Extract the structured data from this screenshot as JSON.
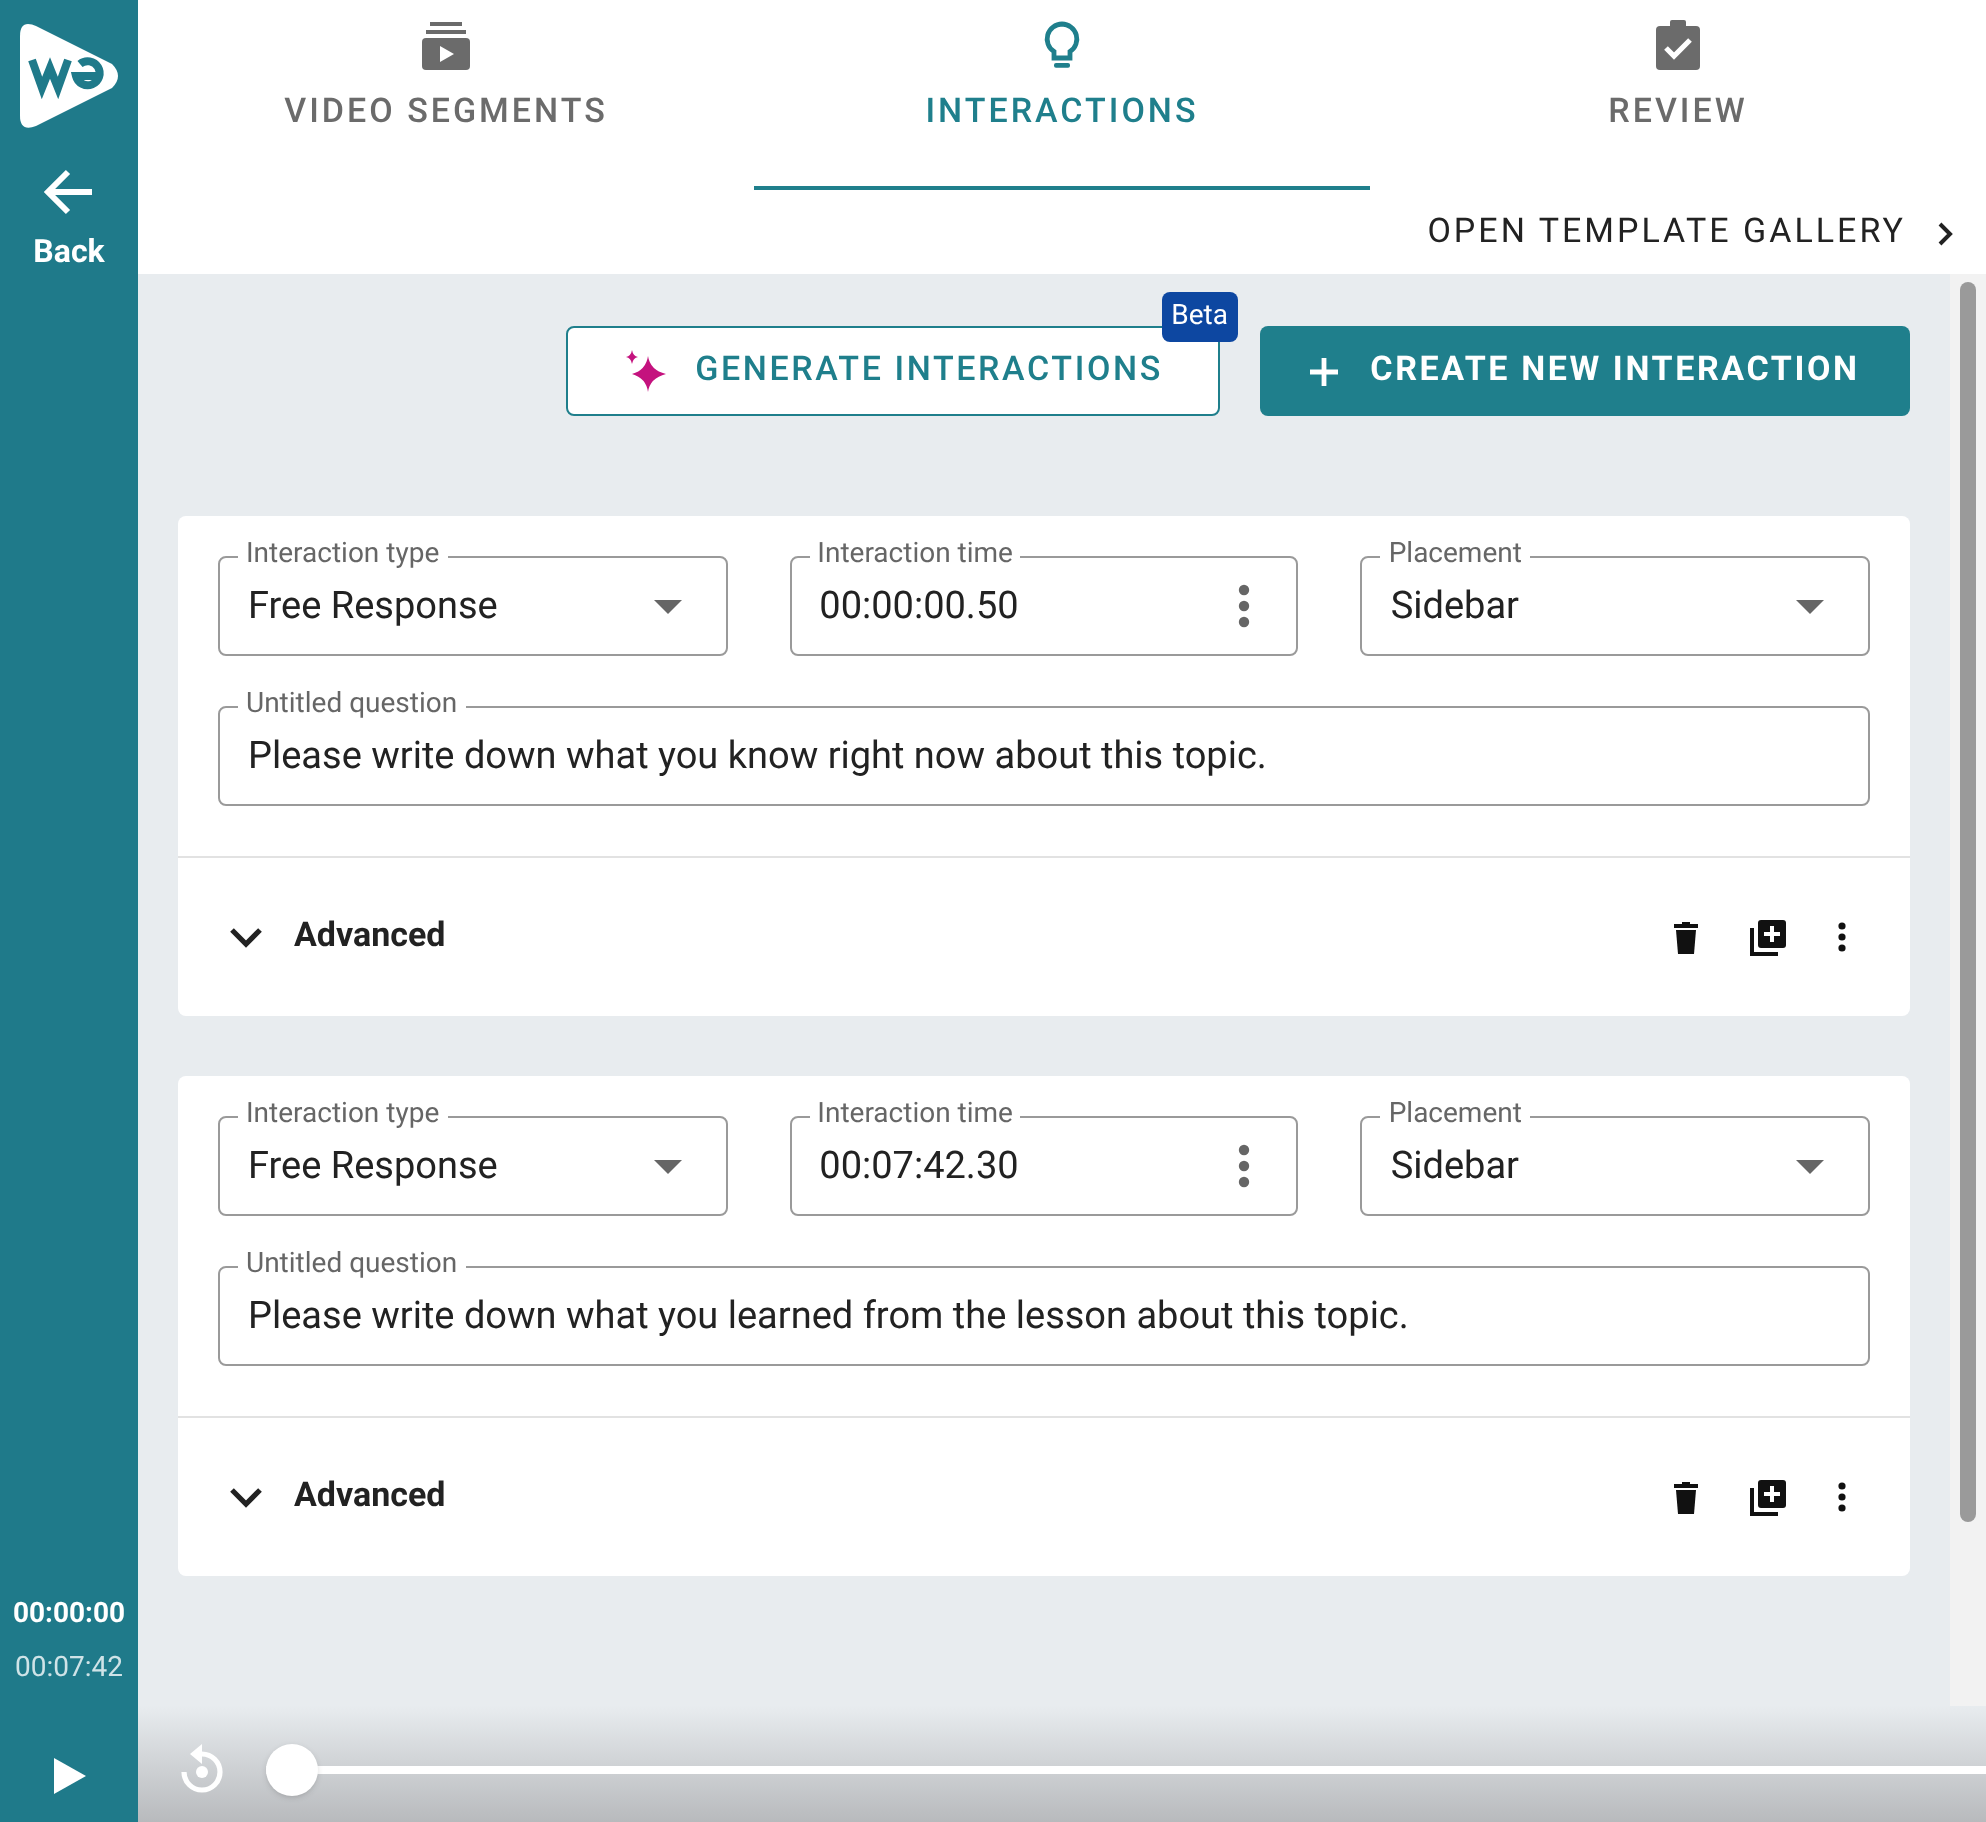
{
  "sidebar": {
    "back_label": "Back",
    "current_time": "00:00:00",
    "total_time": "00:07:42"
  },
  "tabs": [
    {
      "label": "VIDEO SEGMENTS",
      "kind": "video",
      "selected": false
    },
    {
      "label": "INTERACTIONS",
      "kind": "bulb",
      "selected": true
    },
    {
      "label": "REVIEW",
      "kind": "review",
      "selected": false
    }
  ],
  "template_link": "OPEN TEMPLATE GALLERY",
  "generate_button": {
    "label": "GENERATE INTERACTIONS",
    "badge": "Beta"
  },
  "create_button": "CREATE NEW INTERACTION",
  "interactions": [
    {
      "type_label": "Interaction type",
      "type": "Free Response",
      "time_label": "Interaction time",
      "time": "00:00:00.50",
      "placement_label": "Placement",
      "placement": "Sidebar",
      "question_label": "Untitled question",
      "question": "Please write down what you know right now about this topic.",
      "advanced": "Advanced",
      "expanded": false
    },
    {
      "type_label": "Interaction type",
      "type": "Free Response",
      "time_label": "Interaction time",
      "time": "00:07:42.30",
      "placement_label": "Placement",
      "placement": "Sidebar",
      "question_label": "Untitled question",
      "question": "Please write down what you learned from the lesson about this topic.",
      "advanced": "Advanced",
      "expanded": false
    }
  ],
  "player": {
    "level": 0
  }
}
